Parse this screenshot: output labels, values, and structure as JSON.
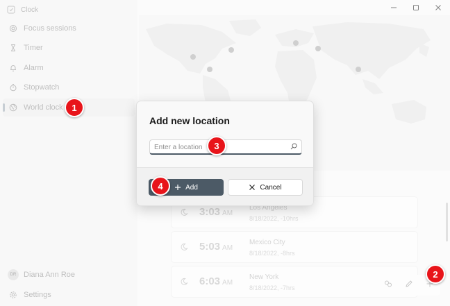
{
  "app": {
    "title": "Clock"
  },
  "sidebar": {
    "items": [
      {
        "label": "Focus sessions",
        "icon": "focus-icon"
      },
      {
        "label": "Timer",
        "icon": "hourglass-icon"
      },
      {
        "label": "Alarm",
        "icon": "bell-icon"
      },
      {
        "label": "Stopwatch",
        "icon": "stopwatch-icon"
      },
      {
        "label": "World clock",
        "icon": "globe-icon",
        "active": true
      }
    ],
    "user": {
      "initials": "DR",
      "name": "Diana Ann Roe"
    },
    "settings_label": "Settings"
  },
  "window_controls": {
    "minimize": "minimize-icon",
    "maximize": "maximize-icon",
    "close": "close-icon"
  },
  "dialog": {
    "title": "Add new location",
    "input_placeholder": "Enter a location",
    "input_value": "",
    "add_label": "Add",
    "cancel_label": "Cancel"
  },
  "clocks": [
    {
      "time": "3:03",
      "ampm": "AM",
      "city": "Los Angeles",
      "meta": "8/18/2022, -10hrs"
    },
    {
      "time": "5:03",
      "ampm": "AM",
      "city": "Mexico City",
      "meta": "8/18/2022, -8hrs"
    },
    {
      "time": "6:03",
      "ampm": "AM",
      "city": "New York",
      "meta": "8/18/2022, -7hrs"
    }
  ],
  "markers": [
    "1",
    "2",
    "3",
    "4"
  ],
  "colors": {
    "accent": "#4c5a66",
    "marker": "#e8141a"
  }
}
